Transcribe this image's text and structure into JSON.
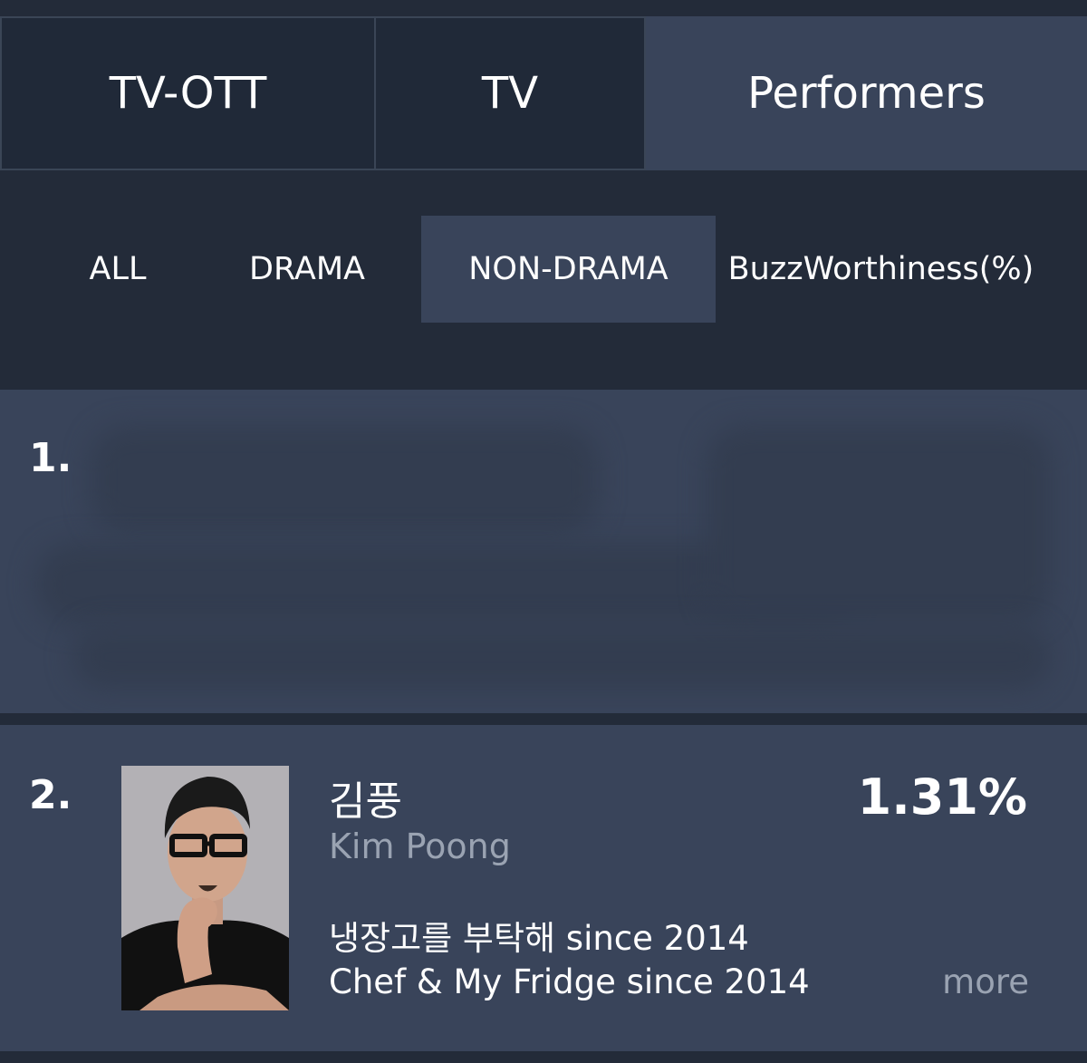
{
  "main_tabs": [
    {
      "label": "TV-OTT",
      "active": false
    },
    {
      "label": "TV",
      "active": false
    },
    {
      "label": "Performers",
      "active": true
    }
  ],
  "sub_tabs": [
    {
      "label": "ALL",
      "active": false
    },
    {
      "label": "DRAMA",
      "active": false
    },
    {
      "label": "NON-DRAMA",
      "active": true
    }
  ],
  "metric_label": "BuzzWorthiness(%)",
  "ranking": [
    {
      "rank": "1.",
      "redacted": true
    },
    {
      "rank": "2.",
      "name_ko": "김풍",
      "name_en": "Kim Poong",
      "percent": "1.31%",
      "show_ko": "냉장고를 부탁해 since 2014",
      "show_en": "Chef & My Fridge since 2014",
      "more_label": "more"
    }
  ],
  "colors": {
    "background": "#232b39",
    "active_tab": "#39445a",
    "card": "#39445a",
    "muted_text": "#9aa3b2"
  }
}
